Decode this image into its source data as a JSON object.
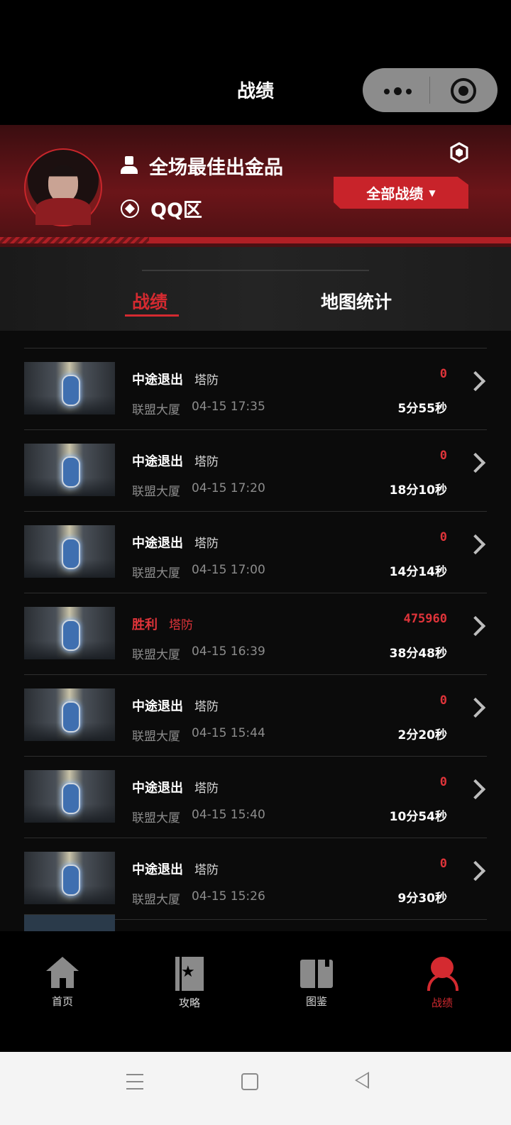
{
  "header": {
    "title": "战绩"
  },
  "profile": {
    "name": "全场最佳出金品",
    "region": "QQ区",
    "filter_button": "全部战绩"
  },
  "tabs": [
    {
      "label": "战绩",
      "active": true
    },
    {
      "label": "地图统计",
      "active": false
    }
  ],
  "records": [
    {
      "result": "中途退出",
      "mode": "塔防",
      "map": "联盟大厦",
      "time": "04-15 17:35",
      "score": "0",
      "duration": "5分55秒",
      "win": false
    },
    {
      "result": "中途退出",
      "mode": "塔防",
      "map": "联盟大厦",
      "time": "04-15 17:20",
      "score": "0",
      "duration": "18分10秒",
      "win": false
    },
    {
      "result": "中途退出",
      "mode": "塔防",
      "map": "联盟大厦",
      "time": "04-15 17:00",
      "score": "0",
      "duration": "14分14秒",
      "win": false
    },
    {
      "result": "胜利",
      "mode": "塔防",
      "map": "联盟大厦",
      "time": "04-15 16:39",
      "score": "475960",
      "duration": "38分48秒",
      "win": true
    },
    {
      "result": "中途退出",
      "mode": "塔防",
      "map": "联盟大厦",
      "time": "04-15 15:44",
      "score": "0",
      "duration": "2分20秒",
      "win": false
    },
    {
      "result": "中途退出",
      "mode": "塔防",
      "map": "联盟大厦",
      "time": "04-15 15:40",
      "score": "0",
      "duration": "10分54秒",
      "win": false
    },
    {
      "result": "中途退出",
      "mode": "塔防",
      "map": "联盟大厦",
      "time": "04-15 15:26",
      "score": "0",
      "duration": "9分30秒",
      "win": false
    }
  ],
  "bottom_nav": [
    {
      "label": "首页",
      "icon": "home-icon",
      "active": false
    },
    {
      "label": "攻略",
      "icon": "guide-icon",
      "active": false
    },
    {
      "label": "图鉴",
      "icon": "book-icon",
      "active": false
    },
    {
      "label": "战绩",
      "icon": "record-icon",
      "active": true
    }
  ],
  "colors": {
    "accent": "#d42a30",
    "background": "#0b0b0b",
    "profile_band": "#6b1519"
  }
}
